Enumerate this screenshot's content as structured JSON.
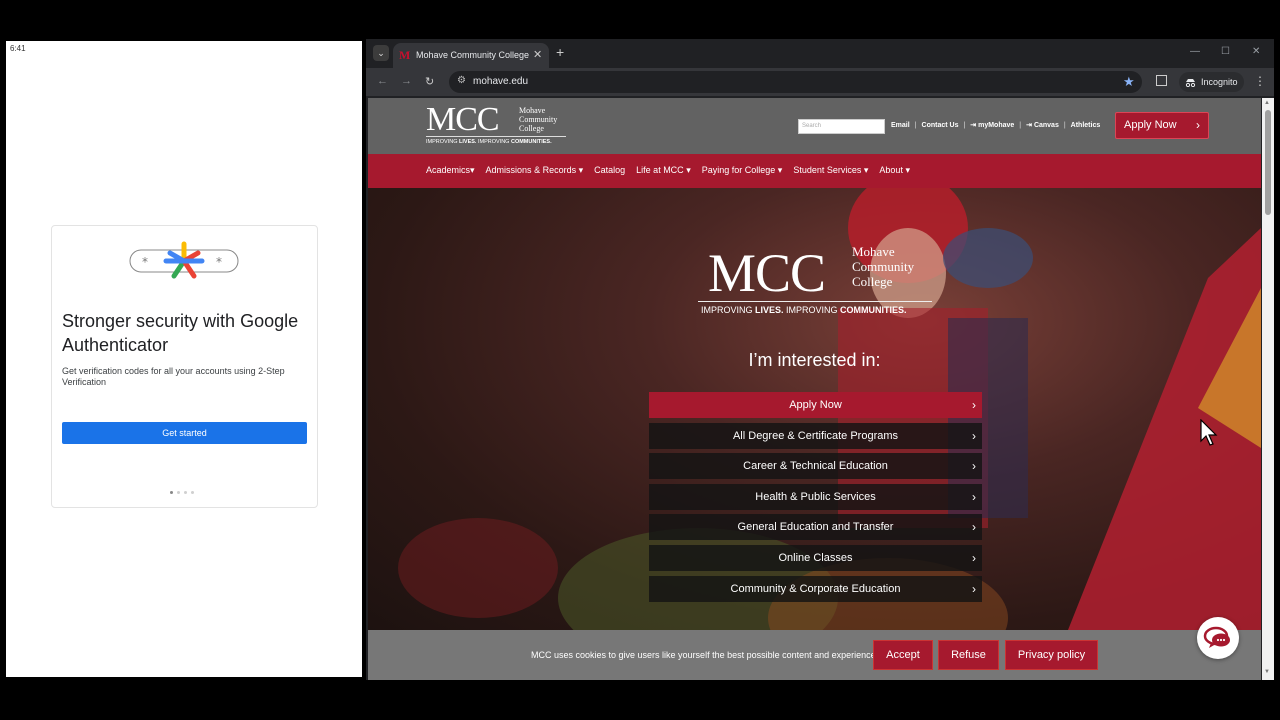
{
  "phone": {
    "time": "6:41",
    "auth_card": {
      "logo_icon": "google-authenticator-logo",
      "title": "Stronger security with Google Authenticator",
      "description": "Get verification codes for all your accounts using 2-Step Verification",
      "button_label": "Get started",
      "page_indicator": {
        "current": 1,
        "total": 4
      }
    }
  },
  "browser": {
    "tab": {
      "title": "Mohave Community College",
      "favicon": "M"
    },
    "omnibox": {
      "url": "mohave.edu"
    },
    "incognito_label": "Incognito"
  },
  "site": {
    "logo": {
      "letters": "MCC",
      "name_line1": "Mohave",
      "name_line2": "Community",
      "name_line3": "College",
      "tagline_a": "IMPROVING ",
      "tagline_b": "LIVES.",
      "tagline_c": " IMPROVING ",
      "tagline_d": "COMMUNITIES."
    },
    "search": {
      "placeholder": "Search"
    },
    "utility_links": [
      "Email",
      "Contact Us",
      "myMohave",
      "Canvas",
      "Athletics"
    ],
    "apply_button": "Apply Now",
    "nav": [
      "Academics",
      "Admissions & Records",
      "Catalog",
      "Life at MCC",
      "Paying for College",
      "Student Services",
      "About"
    ],
    "hero": {
      "heading": "I’m interested in:",
      "programs": [
        "Apply Now",
        "All Degree & Certificate Programs",
        "Career & Technical Education",
        "Health & Public Services",
        "General Education and Transfer",
        "Online Classes",
        "Community & Corporate Education"
      ]
    },
    "cookie": {
      "text": "MCC uses cookies to give users like yourself the best possible content and experience.",
      "accept": "Accept",
      "refuse": "Refuse",
      "privacy": "Privacy policy"
    }
  },
  "colors": {
    "brand_red": "#a6192e",
    "header_gray": "#626262",
    "google_blue": "#1a73e8"
  }
}
